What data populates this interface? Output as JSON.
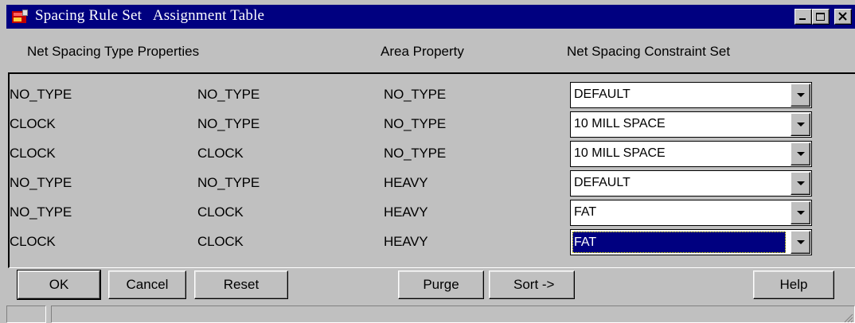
{
  "window": {
    "title": "Spacing Rule Set   Assignment Table",
    "controls": [
      "minimize-icon",
      "maximize-icon",
      "close-icon"
    ]
  },
  "headers": {
    "net_spacing_type": "Net Spacing Type Properties",
    "area_property": "Area Property",
    "constraint_set": "Net Spacing Constraint Set"
  },
  "rows": [
    {
      "type1": "NO_TYPE",
      "type2": "NO_TYPE",
      "area": "NO_TYPE",
      "constraint": "DEFAULT"
    },
    {
      "type1": "CLOCK",
      "type2": "NO_TYPE",
      "area": "NO_TYPE",
      "constraint": "10 MILL SPACE"
    },
    {
      "type1": "CLOCK",
      "type2": "CLOCK",
      "area": "NO_TYPE",
      "constraint": "10 MILL SPACE"
    },
    {
      "type1": "NO_TYPE",
      "type2": "NO_TYPE",
      "area": "HEAVY",
      "constraint": "DEFAULT"
    },
    {
      "type1": "NO_TYPE",
      "type2": "CLOCK",
      "area": "HEAVY",
      "constraint": "FAT"
    },
    {
      "type1": "CLOCK",
      "type2": "CLOCK",
      "area": "HEAVY",
      "constraint": "FAT"
    }
  ],
  "selected_row": 5,
  "buttons": {
    "ok": "OK",
    "cancel": "Cancel",
    "reset": "Reset",
    "purge": "Purge",
    "sort": "Sort ->",
    "help": "Help"
  },
  "colors": {
    "titlebar": "#000080",
    "face": "#c0c0c0",
    "selection": "#000080"
  }
}
